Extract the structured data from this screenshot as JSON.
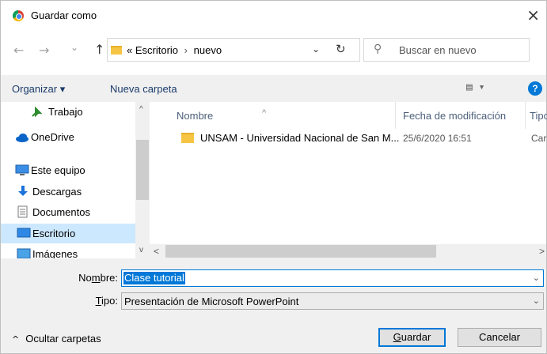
{
  "window": {
    "title": "Guardar como",
    "close_glyph": "×"
  },
  "nav": {
    "back_glyph": "←",
    "forward_glyph": "→",
    "recent_glyph": "⌄",
    "up_glyph": "↑",
    "breadcrumb_prefix": "«",
    "breadcrumb_1": "Escritorio",
    "breadcrumb_sep": "›",
    "breadcrumb_2": "nuevo",
    "dropdown_glyph": "⌄",
    "refresh_glyph": "↻",
    "search_placeholder": "Buscar en nuevo",
    "search_glyph": "⚲"
  },
  "toolbar": {
    "organize_label": "Organizar ▾",
    "new_folder_label": "Nueva carpeta",
    "view_glyph": "▤ ▾",
    "help_glyph": "?"
  },
  "sidebar": {
    "items": [
      {
        "label": "Trabajo",
        "icon": "pin-icon"
      },
      {
        "label": "OneDrive",
        "icon": "cloud-icon"
      },
      {
        "label": "Este equipo",
        "icon": "computer-icon"
      },
      {
        "label": "Descargas",
        "icon": "download-icon"
      },
      {
        "label": "Documentos",
        "icon": "document-icon"
      },
      {
        "label": "Escritorio",
        "icon": "desktop-icon",
        "selected": true
      },
      {
        "label": "Imágenes",
        "icon": "pictures-icon"
      }
    ],
    "scroll_up_glyph": "^",
    "scroll_down_glyph": "v"
  },
  "files": {
    "columns": {
      "name": "Nombre",
      "date": "Fecha de modificación",
      "type": "Tipo"
    },
    "sort_glyph": "^",
    "rows": [
      {
        "name": "UNSAM - Universidad Nacional de San M...",
        "date": "25/6/2020 16:51",
        "type": "Carp"
      }
    ],
    "scroll_left_glyph": "<",
    "scroll_right_glyph": ">"
  },
  "form": {
    "name_label_pre": "No",
    "name_label_key": "m",
    "name_label_post": "bre:",
    "name_value": "Clase tutorial",
    "type_label_key": "T",
    "type_label_post": "ipo:",
    "type_value": "Presentación de Microsoft PowerPoint",
    "dropdown_glyph": "⌄"
  },
  "footer": {
    "hide_folders_glyph": "^",
    "hide_folders_label": "Ocultar carpetas",
    "save_key": "G",
    "save_rest": "uardar",
    "cancel_label": "Cancelar"
  },
  "colors": {
    "accent": "#0078d7",
    "selection": "#cce8ff",
    "folder": "#f6c544"
  }
}
